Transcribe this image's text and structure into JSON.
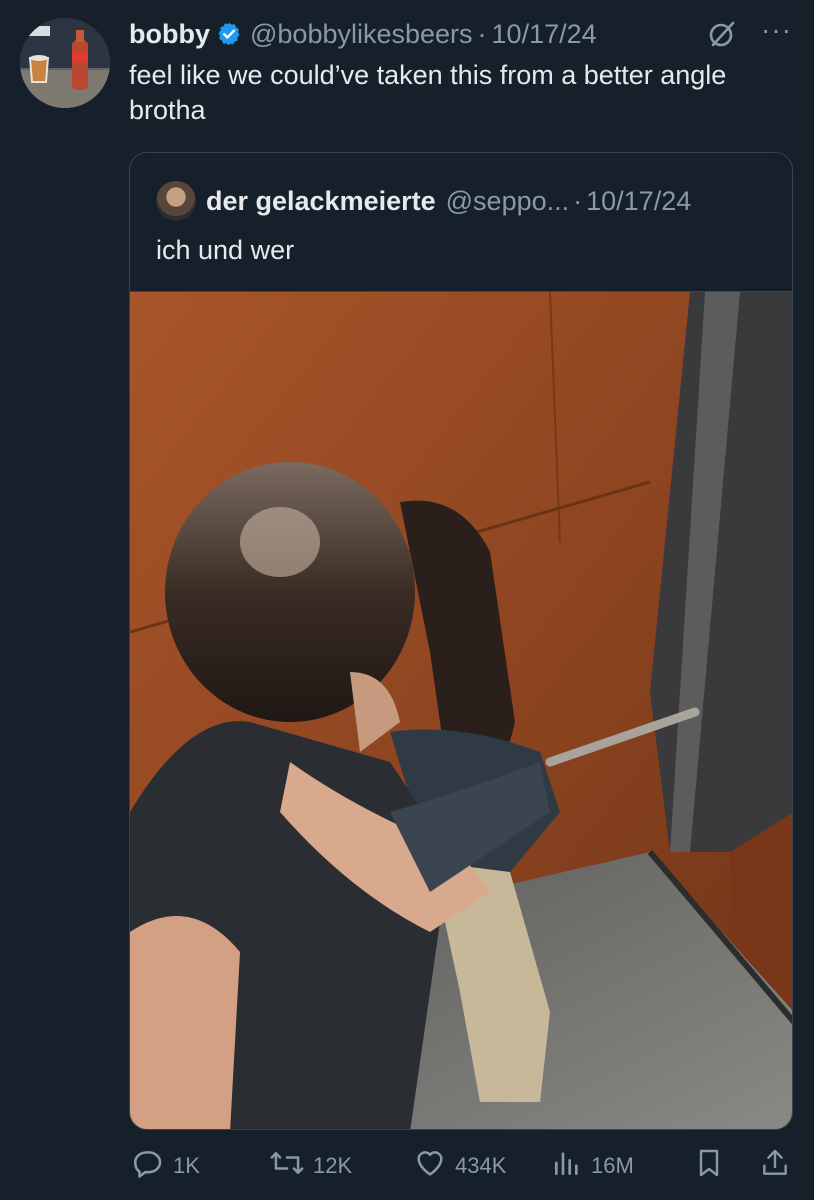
{
  "tweet": {
    "display_name": "bobby",
    "handle": "@bobbylikesbeers",
    "separator": "·",
    "date": "10/17/24",
    "text": "feel like we could’ve taken this from a better angle brotha",
    "more_label": "···"
  },
  "quote": {
    "display_name": "der gelackmeierte",
    "handle": "@seppo...",
    "separator": "·",
    "date": "10/17/24",
    "text": "ich und wer"
  },
  "actions": {
    "replies": "1K",
    "retweets": "12K",
    "likes": "434K",
    "views": "16M"
  },
  "colors": {
    "background": "#15202b",
    "text_primary": "#e7e9ea",
    "text_secondary": "#8b98a5",
    "verified": "#1d9bf0",
    "border": "#38444d"
  },
  "icons": [
    "verified-badge-icon",
    "grok-icon",
    "more-icon",
    "reply-icon",
    "retweet-icon",
    "like-icon",
    "views-icon",
    "bookmark-icon",
    "share-icon"
  ]
}
